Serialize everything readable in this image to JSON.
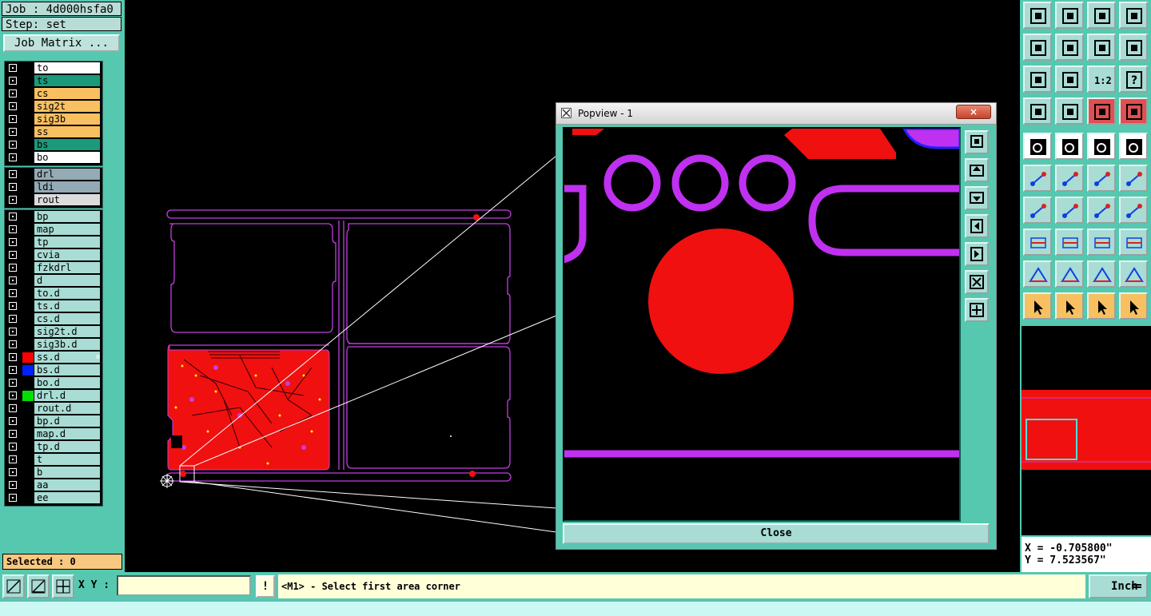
{
  "header": {
    "job": "Job : 4d000hsfa0",
    "step": "Step: set",
    "job_matrix_label": "Job Matrix ..."
  },
  "layers": {
    "group1": [
      {
        "name": "to",
        "color": "#ffffff",
        "swatch": "#000000"
      },
      {
        "name": "ts",
        "color": "#1a9a7a",
        "swatch": "#000000"
      },
      {
        "name": "cs",
        "color": "#f8c060",
        "swatch": "#000000"
      },
      {
        "name": "sig2t",
        "color": "#f8c060",
        "swatch": "#000000"
      },
      {
        "name": "sig3b",
        "color": "#f8c060",
        "swatch": "#000000"
      },
      {
        "name": "ss",
        "color": "#f8c060",
        "swatch": "#000000"
      },
      {
        "name": "bs",
        "color": "#1a9a7a",
        "swatch": "#000000"
      },
      {
        "name": "bo",
        "color": "#ffffff",
        "swatch": "#000000"
      }
    ],
    "group2": [
      {
        "name": "drl",
        "color": "#94aab4",
        "swatch": "#000000"
      },
      {
        "name": "ldi",
        "color": "#94aab4",
        "swatch": "#000000"
      },
      {
        "name": "rout",
        "color": "#dcdcdc",
        "swatch": "#000000"
      }
    ],
    "group3": [
      {
        "name": "bp",
        "color": "#a8dcd4",
        "swatch": "#000000"
      },
      {
        "name": "map",
        "color": "#a8dcd4",
        "swatch": "#000000"
      },
      {
        "name": "tp",
        "color": "#a8dcd4",
        "swatch": "#000000"
      },
      {
        "name": "cvia",
        "color": "#a8dcd4",
        "swatch": "#000000"
      },
      {
        "name": "fzkdrl",
        "color": "#a8dcd4",
        "swatch": "#000000"
      },
      {
        "name": "d",
        "color": "#a8dcd4",
        "swatch": "#000000"
      },
      {
        "name": "to.d",
        "color": "#a8dcd4",
        "swatch": "#000000"
      },
      {
        "name": "ts.d",
        "color": "#a8dcd4",
        "swatch": "#000000"
      },
      {
        "name": "cs.d",
        "color": "#a8dcd4",
        "swatch": "#000000"
      },
      {
        "name": "sig2t.d",
        "color": "#a8dcd4",
        "swatch": "#000000"
      },
      {
        "name": "sig3b.d",
        "color": "#a8dcd4",
        "swatch": "#000000"
      },
      {
        "name": "ss.d",
        "color": "#a8dcd4",
        "swatch": "#ff0000",
        "marked": true
      },
      {
        "name": "bs.d",
        "color": "#a8dcd4",
        "swatch": "#0020ff"
      },
      {
        "name": "bo.d",
        "color": "#a8dcd4",
        "swatch": "#000000"
      },
      {
        "name": "drl.d",
        "color": "#a8dcd4",
        "swatch": "#00e000"
      },
      {
        "name": "rout.d",
        "color": "#a8dcd4",
        "swatch": "#000000"
      },
      {
        "name": "bp.d",
        "color": "#a8dcd4",
        "swatch": "#000000"
      },
      {
        "name": "map.d",
        "color": "#a8dcd4",
        "swatch": "#000000"
      },
      {
        "name": "tp.d",
        "color": "#a8dcd4",
        "swatch": "#000000"
      },
      {
        "name": "t",
        "color": "#a8dcd4",
        "swatch": "#000000"
      },
      {
        "name": "b",
        "color": "#a8dcd4",
        "swatch": "#000000"
      },
      {
        "name": "aa",
        "color": "#a8dcd4",
        "swatch": "#000000"
      },
      {
        "name": "ee",
        "color": "#a8dcd4",
        "swatch": "#000000"
      }
    ]
  },
  "selected_label": "Selected : 0",
  "popview": {
    "title": "Popview - 1",
    "close_label": "Close",
    "x_glyph": "×"
  },
  "toolbar_icons": [
    "zoom-home-icon",
    "zoom-up-icon",
    "home-view-icon",
    "grid-view-icon",
    "pan-left-icon",
    "pan-right-icon",
    "swap-icon",
    "wave-icon",
    "fit-all-icon",
    "fit-center-icon",
    "ratio-icon",
    "help-icon",
    "tools-icon",
    "probe-icon",
    "layer-up-icon",
    "layer-down-icon",
    "snap-pad-icon",
    "snap-line-icon",
    "measure-icon",
    "fill-circle-icon",
    "node-graph-icon",
    "cross-icon",
    "arc-right-icon",
    "arc-dir-icon",
    "angle-icon",
    "diagonal-icon",
    "rotate-icon",
    "flip-icon",
    "drag-box-icon",
    "center-line-icon",
    "dimension-icon",
    "pad-group-icon",
    "triangle-a-icon",
    "triangle-b-icon",
    "triangle-c-icon",
    "triangle-d-icon",
    "select-pointer-icon",
    "select-box-icon",
    "select-shape-icon",
    "select-net-icon"
  ],
  "ratio_label": "1:2",
  "coords": {
    "x": "X = -0.705800\"",
    "y": "Y = 7.523567\""
  },
  "bottom": {
    "xy_label": "X Y :",
    "xy_value": "",
    "warn": "!",
    "prompt": "<M1> - Select first area corner",
    "unit": "Inch"
  }
}
